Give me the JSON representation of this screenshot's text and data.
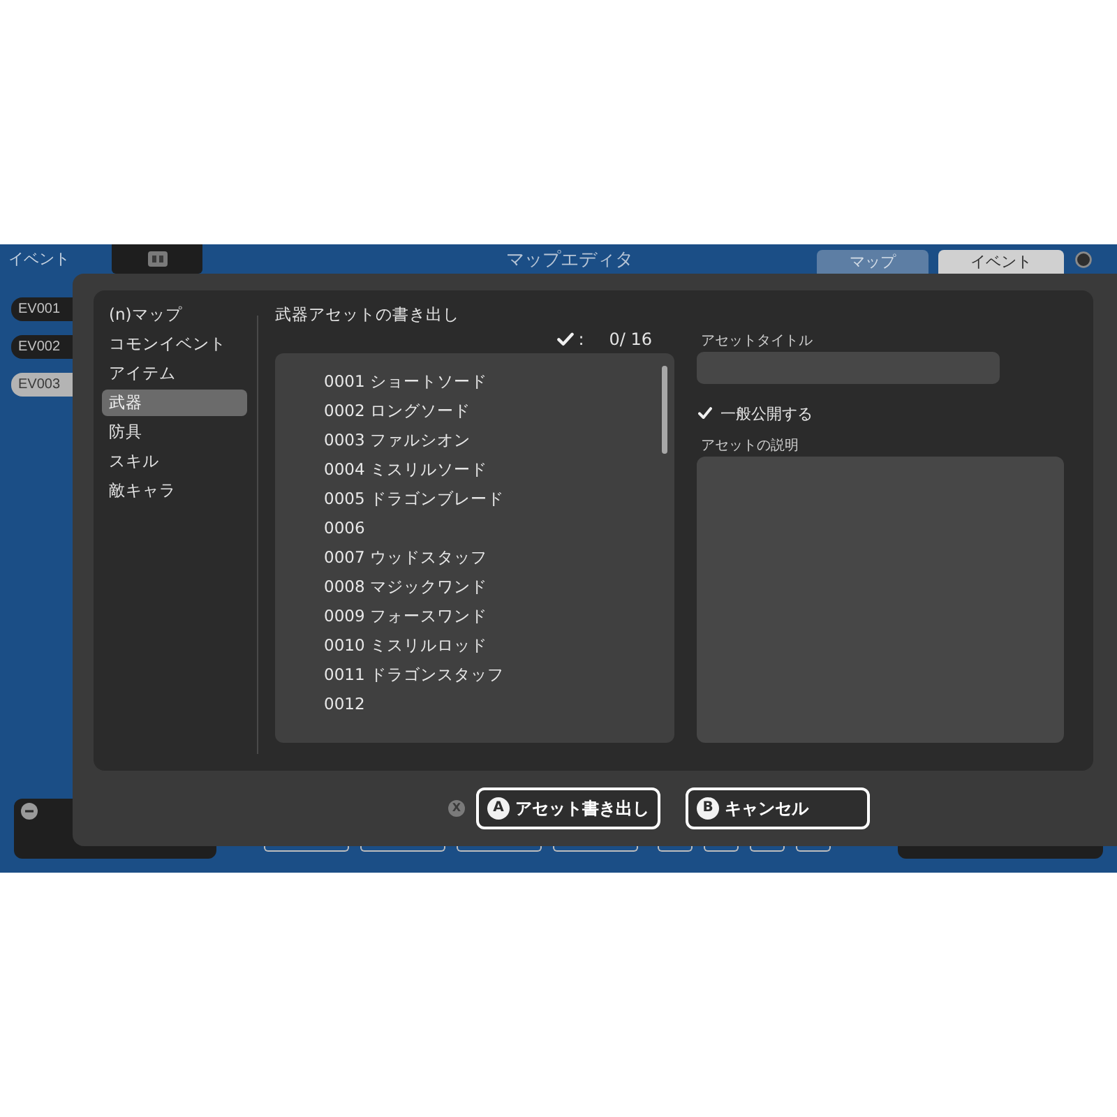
{
  "editor": {
    "side_label": "イベント",
    "title": "マップエディタ",
    "tabs": [
      {
        "label": "マップ",
        "selected": false
      },
      {
        "label": "イベント",
        "selected": true
      }
    ],
    "events": [
      {
        "label": "EV001",
        "selected": false
      },
      {
        "label": "EV002",
        "selected": false
      },
      {
        "label": "EV003",
        "selected": true
      }
    ]
  },
  "dialog": {
    "categories": [
      {
        "label": "(n)マップ",
        "selected": false
      },
      {
        "label": "コモンイベント",
        "selected": false
      },
      {
        "label": "アイテム",
        "selected": false
      },
      {
        "label": "武器",
        "selected": true
      },
      {
        "label": "防具",
        "selected": false
      },
      {
        "label": "スキル",
        "selected": false
      },
      {
        "label": "敵キャラ",
        "selected": false
      }
    ],
    "heading": "武器アセットの書き出し",
    "counter": {
      "colon": ":",
      "value": "0/ 16"
    },
    "assets": [
      "0001 ショートソード",
      "0002 ロングソード",
      "0003 ファルシオン",
      "0004 ミスリルソード",
      "0005 ドラゴンブレード",
      "0006",
      "0007 ウッドスタッフ",
      "0008 マジックワンド",
      "0009 フォースワンド",
      "0010 ミスリルロッド",
      "0011 ドラゴンスタッフ",
      "0012"
    ],
    "title_field": {
      "label": "アセットタイトル"
    },
    "public_checkbox": {
      "label": "一般公開する",
      "checked": true
    },
    "description_field": {
      "label": "アセットの説明"
    },
    "hint_glyph": "X",
    "buttons": [
      {
        "glyph": "A",
        "label": "アセット書き出し"
      },
      {
        "glyph": "B",
        "label": "キャンセル"
      }
    ]
  }
}
